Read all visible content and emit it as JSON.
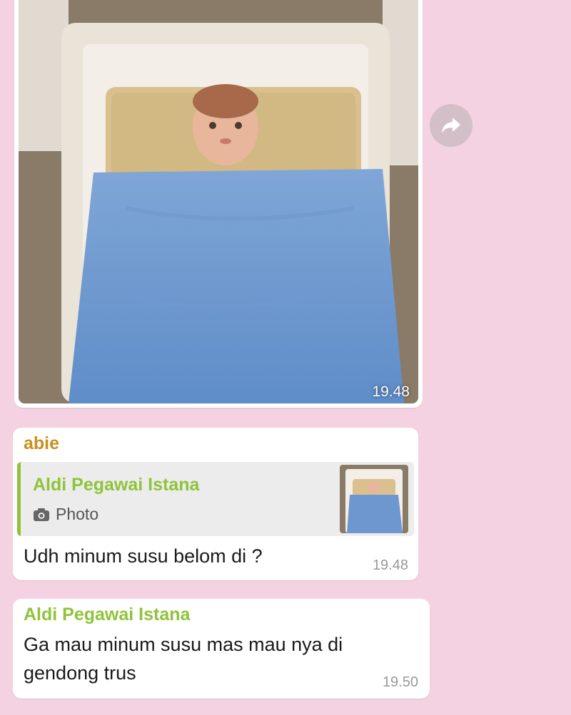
{
  "photo_message": {
    "time": "19.48",
    "image_description_icon": "baby-doll-photo"
  },
  "forward": {
    "icon": "forward-icon"
  },
  "reply_message": {
    "sender": "abie",
    "quoted": {
      "sender": "Aldi  Pegawai Istana",
      "type_icon": "camera-icon",
      "type_label": "Photo"
    },
    "text": "Udh minum susu belom di ?",
    "time": "19.48"
  },
  "plain_message": {
    "sender": "Aldi  Pegawai Istana",
    "text": "Ga mau minum susu mas mau nya di gendong trus",
    "time": "19.50"
  },
  "colors": {
    "background": "#f4d2e2",
    "bubble": "#ffffff",
    "sender_abie": "#c8901e",
    "sender_aldi": "#8fc33a"
  }
}
